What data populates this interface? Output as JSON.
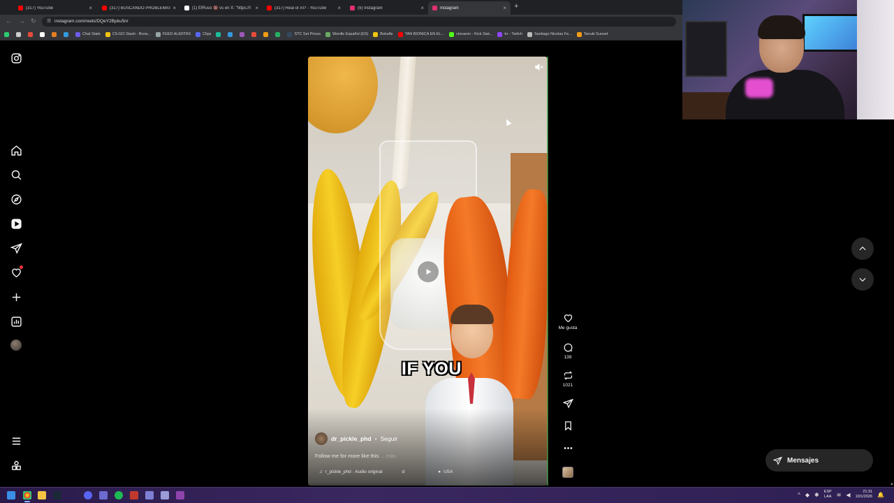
{
  "browser": {
    "tabs": [
      {
        "title": "(317) YouTube",
        "color": "#ff0000"
      },
      {
        "title": "(317) BUSCANDO PROBLEMAS",
        "color": "#ff0000"
      },
      {
        "title": "(1) ElRuso 🔞 vs en X: \"https://\\",
        "color": "#ffffff"
      },
      {
        "title": "(317) Real or AI? - YouTube",
        "color": "#ff0000"
      },
      {
        "title": "(9) Instagram",
        "color": "#e1306c"
      },
      {
        "title": "Instagram",
        "color": "#e1306c"
      }
    ],
    "active_tab_index": 5,
    "url": "instagram.com/reels/DQeY2Bpku5n/",
    "bookmarks": [
      {
        "label": "",
        "color": "#2ecc71"
      },
      {
        "label": "",
        "color": "#cccccc"
      },
      {
        "label": "",
        "color": "#e74c3c"
      },
      {
        "label": "",
        "color": "#ffffff"
      },
      {
        "label": "",
        "color": "#e67e22"
      },
      {
        "label": "",
        "color": "#3498db"
      },
      {
        "label": "Chat Stats",
        "color": "#6c5ce7"
      },
      {
        "label": "CS:GO Stash - Brow...",
        "color": "#f1c40f"
      },
      {
        "label": "FEED ALERTAS",
        "color": "#95a5a6"
      },
      {
        "label": "Clips",
        "color": "#5865f2"
      },
      {
        "label": "",
        "color": "#1abc9c"
      },
      {
        "label": "",
        "color": "#3498db"
      },
      {
        "label": "",
        "color": "#9b59b6"
      },
      {
        "label": "",
        "color": "#e74c3c"
      },
      {
        "label": "",
        "color": "#f39c12"
      },
      {
        "label": "",
        "color": "#27ae60"
      },
      {
        "label": "STC Set Prices",
        "color": "#34495e"
      },
      {
        "label": "Wordle Español (ES)",
        "color": "#6aaa64"
      },
      {
        "label": "Boludle",
        "color": "#f1c40f"
      },
      {
        "label": "TAN BIONICA EN EL...",
        "color": "#ff0000"
      },
      {
        "label": "cionaron - Kick Stat...",
        "color": "#53fc18"
      },
      {
        "label": "trr - Twitch",
        "color": "#9146ff"
      },
      {
        "label": "Santiago Nicolas Fe...",
        "color": "#bbbbbb"
      },
      {
        "label": "Tanuki Sunset",
        "color": "#f39c12"
      }
    ]
  },
  "sidebar": {
    "items": [
      {
        "name": "instagram-logo-icon",
        "interactable": true
      },
      {
        "name": "home-icon",
        "interactable": true
      },
      {
        "name": "search-icon",
        "interactable": true
      },
      {
        "name": "explore-icon",
        "interactable": true
      },
      {
        "name": "reels-icon",
        "interactable": true
      },
      {
        "name": "messages-icon",
        "interactable": true
      },
      {
        "name": "notifications-icon",
        "interactable": true
      },
      {
        "name": "create-icon",
        "interactable": true
      },
      {
        "name": "dashboard-icon",
        "interactable": true
      },
      {
        "name": "profile-avatar",
        "interactable": true
      },
      {
        "name": "more-menu-icon",
        "interactable": true
      },
      {
        "name": "threads-icon",
        "interactable": true
      }
    ]
  },
  "reel": {
    "overlay_caption": "IF YOU",
    "author": "dr_pickle_phd",
    "separator": "•",
    "follow_label": "Seguir",
    "description": "Follow me for more like this",
    "description_more": "... más",
    "audio": "r_pickle_phd · Audio original",
    "audio_extra": "d",
    "location": "USA",
    "muted": true
  },
  "actions": {
    "like_label": "Me gusta",
    "comments_count": "139",
    "reposts_count": "1021"
  },
  "messages_pill": {
    "label": "Mensajes"
  },
  "taskbar": {
    "language_top": "ESP",
    "language_bottom": "LAA",
    "time": "21:31",
    "date": "10/1/2026"
  }
}
